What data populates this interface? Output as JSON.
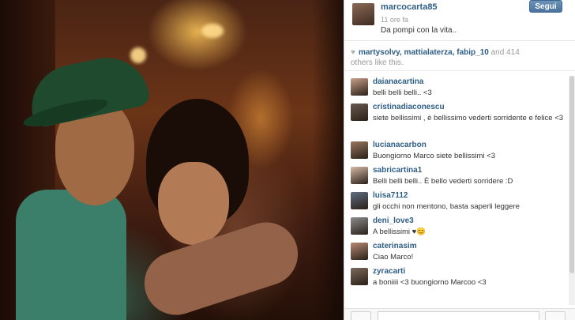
{
  "post": {
    "username": "marcocarta85",
    "time": "11 ore fa",
    "caption": "Da pompi con la vita..",
    "follow_label": "Segui"
  },
  "likes": {
    "likers": "martysolvy, mattialaterza, fabip_10",
    "suffix": " and 414",
    "line2": "others like this."
  },
  "comments": [
    {
      "user": "daianacartina",
      "text": "belli belli belli.. <3",
      "color": "#c9a08b"
    },
    {
      "user": "cristinadiaconescu",
      "text": "siete bellissimi , è bellissimo vederti sorridente e felice <3",
      "color": "#6b5a4e"
    },
    {
      "user": "lucianacarbon",
      "text": "Buongiorno Marco siete bellissimi <3",
      "color": "#9a7760"
    },
    {
      "user": "sabricartina1",
      "text": "Belli belli belli.. È bello vederti sorridere :D",
      "color": "#d8b9a6"
    },
    {
      "user": "luisa7112",
      "text": "gli occhi non mentono, basta saperli leggere",
      "color": "#5f6e82"
    },
    {
      "user": "deni_love3",
      "text": "A bellissimi ♥😊",
      "color": "#8d8d8d"
    },
    {
      "user": "caterinasim",
      "text": "Ciao Marco!",
      "color": "#b58a72"
    },
    {
      "user": "zyracarti",
      "text": "a boniiii <3 buongiorno Marcoo <3",
      "color": "#7b6a5c"
    }
  ]
}
